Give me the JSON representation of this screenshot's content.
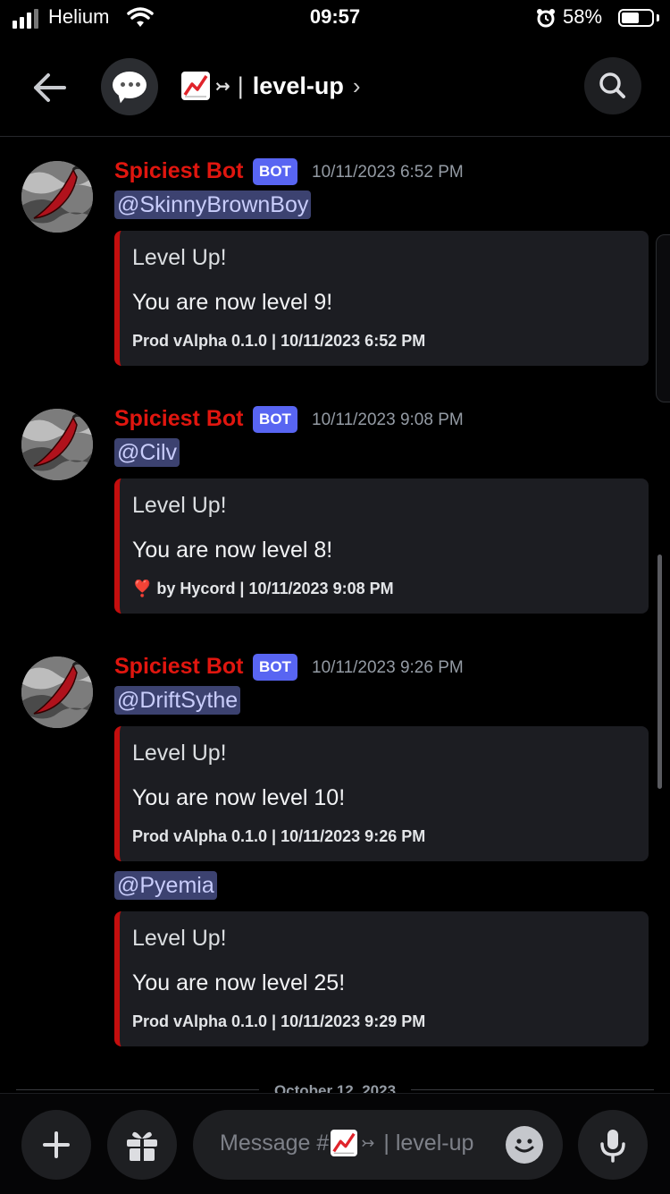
{
  "status_bar": {
    "carrier": "Helium",
    "time": "09:57",
    "battery_percent": "58%",
    "battery_level": 0.58
  },
  "header": {
    "channel_prefix_arrow": "↣",
    "channel_separator": "|",
    "channel_name": "level-up",
    "chevron": "›"
  },
  "messages": [
    {
      "username": "Spiciest Bot",
      "badge": "BOT",
      "timestamp": "10/11/2023 6:52 PM",
      "mention": "@SkinnyBrownBoy",
      "embed_title": "Level Up!",
      "embed_description": "You are now level 9!",
      "embed_footer": "Prod vAlpha 0.1.0 | 10/11/2023 6:52 PM"
    },
    {
      "username": "Spiciest Bot",
      "badge": "BOT",
      "timestamp": "10/11/2023 9:08 PM",
      "mention": "@Cilv",
      "embed_title": "Level Up!",
      "embed_description": "You are now level 8!",
      "embed_footer": "❣️ by Hycord | 10/11/2023 9:08 PM"
    },
    {
      "username": "Spiciest Bot",
      "badge": "BOT",
      "timestamp": "10/11/2023 9:26 PM",
      "mention": "@DriftSythe",
      "embed_title": "Level Up!",
      "embed_description": "You are now level 10!",
      "embed_footer": "Prod vAlpha 0.1.0 | 10/11/2023 9:26 PM"
    },
    {
      "mention": "@Pyemia",
      "embed_title": "Level Up!",
      "embed_description": "You are now level 25!",
      "embed_footer": "Prod vAlpha 0.1.0 | 10/11/2023 9:29 PM"
    }
  ],
  "date_divider": "October 12, 2023",
  "composer": {
    "placeholder_prefix": "Message #",
    "placeholder_arrow": "↣",
    "placeholder_channel": "| level-up"
  },
  "colors": {
    "username": "#e0160f",
    "bot_badge": "#5865f2",
    "embed_accent": "#c40e0e",
    "mention_bg": "#3c4270"
  }
}
